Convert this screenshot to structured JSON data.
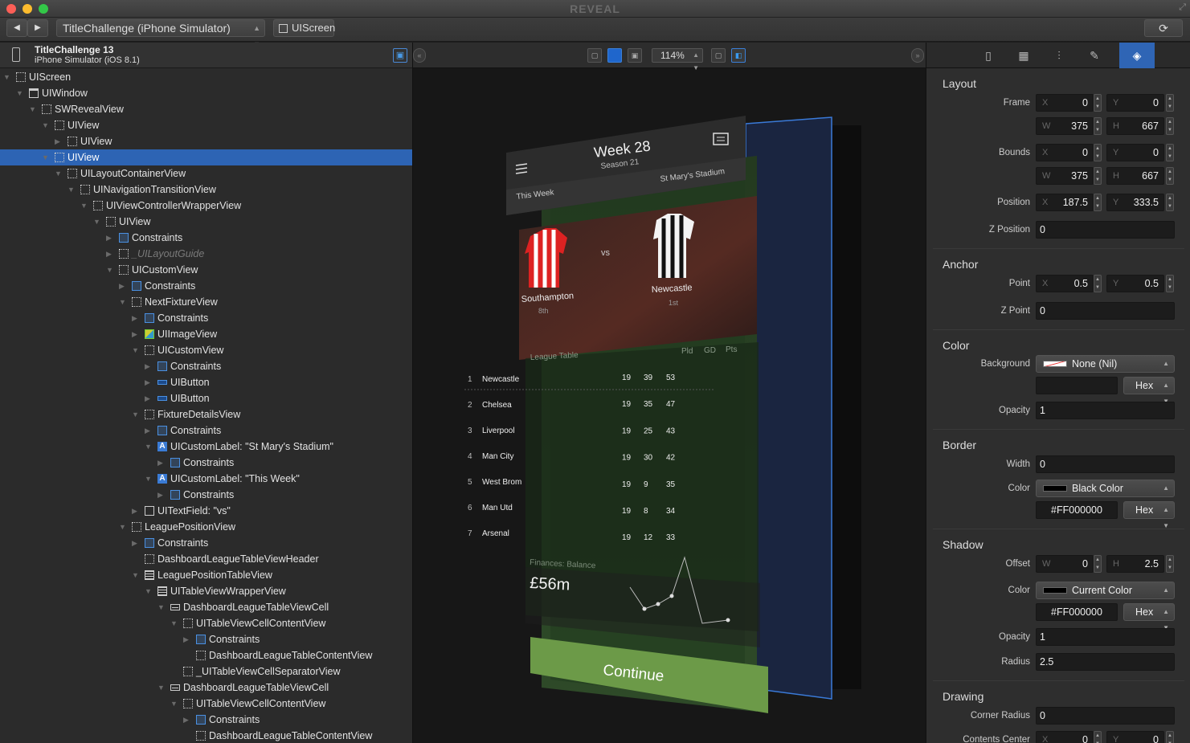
{
  "window": {
    "title": "REVEAL",
    "fullscreen_glyph": "⤢"
  },
  "toolbar": {
    "back_glyph": "◀",
    "forward_glyph": "▶",
    "app_select": "TitleChallenge (iPhone Simulator)",
    "screen_pill": "UIScreen",
    "refresh_glyph": "⟳"
  },
  "device": {
    "name": "TitleChallenge 13",
    "sub": "iPhone Simulator (iOS 8.1)"
  },
  "tree": [
    {
      "label": "UIScreen",
      "depth": 0,
      "icon": "box-icon",
      "disc": "open"
    },
    {
      "label": "UIWindow",
      "depth": 1,
      "icon": "window-icon",
      "disc": "open"
    },
    {
      "label": "SWRevealView",
      "depth": 2,
      "icon": "box-icon",
      "disc": "open"
    },
    {
      "label": "UIView",
      "depth": 3,
      "icon": "box-icon",
      "disc": "open"
    },
    {
      "label": "UIView",
      "depth": 4,
      "icon": "box-icon",
      "disc": "closed"
    },
    {
      "label": "UIView",
      "depth": 3,
      "icon": "box-icon",
      "disc": "open",
      "selected": true
    },
    {
      "label": "UILayoutContainerView",
      "depth": 4,
      "icon": "box-icon",
      "disc": "open"
    },
    {
      "label": "UINavigationTransitionView",
      "depth": 5,
      "icon": "box-icon",
      "disc": "open"
    },
    {
      "label": "UIViewControllerWrapperView",
      "depth": 6,
      "icon": "box-icon",
      "disc": "open"
    },
    {
      "label": "UIView",
      "depth": 7,
      "icon": "box-icon",
      "disc": "open"
    },
    {
      "label": "Constraints",
      "depth": 8,
      "icon": "constraints-icon",
      "disc": "closed"
    },
    {
      "label": "_UILayoutGuide",
      "depth": 8,
      "icon": "box-icon",
      "disc": "closed",
      "dim": true
    },
    {
      "label": "UICustomView",
      "depth": 8,
      "icon": "box-icon",
      "disc": "open"
    },
    {
      "label": "Constraints",
      "depth": 9,
      "icon": "constraints-icon",
      "disc": "closed"
    },
    {
      "label": "NextFixtureView",
      "depth": 9,
      "icon": "box-icon",
      "disc": "open"
    },
    {
      "label": "Constraints",
      "depth": 10,
      "icon": "constraints-icon",
      "disc": "closed"
    },
    {
      "label": "UIImageView",
      "depth": 10,
      "icon": "image-icon",
      "disc": "closed"
    },
    {
      "label": "UICustomView",
      "depth": 10,
      "icon": "box-icon",
      "disc": "open"
    },
    {
      "label": "Constraints",
      "depth": 11,
      "icon": "constraints-icon",
      "disc": "closed"
    },
    {
      "label": "UIButton",
      "depth": 11,
      "icon": "button-icon",
      "disc": "closed"
    },
    {
      "label": "UIButton",
      "depth": 11,
      "icon": "button-icon",
      "disc": "closed"
    },
    {
      "label": "FixtureDetailsView",
      "depth": 10,
      "icon": "box-icon",
      "disc": "open"
    },
    {
      "label": "Constraints",
      "depth": 11,
      "icon": "constraints-icon",
      "disc": "closed"
    },
    {
      "label": "UICustomLabel: \"St Mary's Stadium\"",
      "depth": 11,
      "icon": "label-icon",
      "disc": "open"
    },
    {
      "label": "Constraints",
      "depth": 12,
      "icon": "constraints-icon",
      "disc": "closed"
    },
    {
      "label": "UICustomLabel: \"This Week\"",
      "depth": 11,
      "icon": "label-icon",
      "disc": "open"
    },
    {
      "label": "Constraints",
      "depth": 12,
      "icon": "constraints-icon",
      "disc": "closed"
    },
    {
      "label": "UITextField: \"vs\"",
      "depth": 10,
      "icon": "textfield-icon",
      "disc": "closed"
    },
    {
      "label": "LeaguePositionView",
      "depth": 9,
      "icon": "box-icon",
      "disc": "open"
    },
    {
      "label": "Constraints",
      "depth": 10,
      "icon": "constraints-icon",
      "disc": "closed"
    },
    {
      "label": "DashboardLeagueTableViewHeader",
      "depth": 10,
      "icon": "box-icon",
      "disc": "none"
    },
    {
      "label": "LeaguePositionTableView",
      "depth": 10,
      "icon": "table-icon",
      "disc": "open"
    },
    {
      "label": "UITableViewWrapperView",
      "depth": 11,
      "icon": "table-icon",
      "disc": "open"
    },
    {
      "label": "DashboardLeagueTableViewCell",
      "depth": 12,
      "icon": "cell-icon",
      "disc": "open"
    },
    {
      "label": "UITableViewCellContentView",
      "depth": 13,
      "icon": "box-icon",
      "disc": "open"
    },
    {
      "label": "Constraints",
      "depth": 14,
      "icon": "constraints-icon",
      "disc": "closed"
    },
    {
      "label": "DashboardLeagueTableContentView",
      "depth": 14,
      "icon": "box-icon",
      "disc": "none"
    },
    {
      "label": "_UITableViewCellSeparatorView",
      "depth": 13,
      "icon": "box-icon",
      "disc": "none"
    },
    {
      "label": "DashboardLeagueTableViewCell",
      "depth": 12,
      "icon": "cell-icon",
      "disc": "open"
    },
    {
      "label": "UITableViewCellContentView",
      "depth": 13,
      "icon": "box-icon",
      "disc": "open"
    },
    {
      "label": "Constraints",
      "depth": 14,
      "icon": "constraints-icon",
      "disc": "closed"
    },
    {
      "label": "DashboardLeagueTableContentView",
      "depth": 14,
      "icon": "box-icon",
      "disc": "none"
    }
  ],
  "canvas": {
    "zoom": "114%",
    "collapse_left": "«",
    "collapse_right": "»"
  },
  "app_preview": {
    "week": "Week 28",
    "season": "Season 21",
    "stadium": "St Mary's Stadium",
    "this_week": "This Week",
    "home_team": "Southampton",
    "home_pos": "8th",
    "away_team": "Newcastle",
    "away_pos": "1st",
    "vs": "vs",
    "table_title": "League Table",
    "col_pld": "Pld",
    "col_gd": "GD",
    "col_pts": "Pts",
    "rows": [
      {
        "pos": "1",
        "team": "Newcastle",
        "pld": "19",
        "gd": "39",
        "pts": "53"
      },
      {
        "pos": "2",
        "team": "Chelsea",
        "pld": "19",
        "gd": "35",
        "pts": "47"
      },
      {
        "pos": "3",
        "team": "Liverpool",
        "pld": "19",
        "gd": "25",
        "pts": "43"
      },
      {
        "pos": "4",
        "team": "Man City",
        "pld": "19",
        "gd": "30",
        "pts": "42"
      },
      {
        "pos": "5",
        "team": "West Brom",
        "pld": "19",
        "gd": "9",
        "pts": "35"
      },
      {
        "pos": "6",
        "team": "Man Utd",
        "pld": "19",
        "gd": "8",
        "pts": "34"
      },
      {
        "pos": "7",
        "team": "Arsenal",
        "pld": "19",
        "gd": "12",
        "pts": "33"
      }
    ],
    "finances_label": "Finances: Balance",
    "balance": "£56m",
    "continue": "Continue"
  },
  "inspector": {
    "layout": {
      "title": "Layout",
      "frame_label": "Frame",
      "frame_x": "0",
      "frame_y": "0",
      "frame_w": "375",
      "frame_h": "667",
      "bounds_label": "Bounds",
      "bounds_x": "0",
      "bounds_y": "0",
      "bounds_w": "375",
      "bounds_h": "667",
      "position_label": "Position",
      "pos_x": "187.5",
      "pos_y": "333.5",
      "zpos_label": "Z Position",
      "zpos": "0"
    },
    "anchor": {
      "title": "Anchor",
      "point_label": "Point",
      "x": "0.5",
      "y": "0.5",
      "zpoint_label": "Z Point",
      "zpoint": "0"
    },
    "color": {
      "title": "Color",
      "bg_label": "Background",
      "bg_value": "None (Nil)",
      "hex_btn": "Hex",
      "opacity_label": "Opacity",
      "opacity": "1"
    },
    "border": {
      "title": "Border",
      "width_label": "Width",
      "width": "0",
      "color_label": "Color",
      "color_value": "Black Color",
      "hex": "#FF000000",
      "hex_btn": "Hex"
    },
    "shadow": {
      "title": "Shadow",
      "offset_label": "Offset",
      "offset_w": "0",
      "offset_h": "2.5",
      "color_label": "Color",
      "color_value": "Current Color",
      "hex": "#FF000000",
      "hex_btn": "Hex",
      "opacity_label": "Opacity",
      "opacity": "1",
      "radius_label": "Radius",
      "radius": "2.5"
    },
    "drawing": {
      "title": "Drawing",
      "corner_label": "Corner Radius",
      "corner": "0",
      "contents_label": "Contents Center",
      "cx": "0",
      "cy": "0"
    }
  },
  "labels": {
    "x": "X",
    "y": "Y",
    "w": "W",
    "h": "H"
  },
  "colors": {
    "selection": "#2d64b4",
    "accent": "#3a80d8",
    "pitch": "#2a4a24",
    "continue": "#6c9a48"
  }
}
